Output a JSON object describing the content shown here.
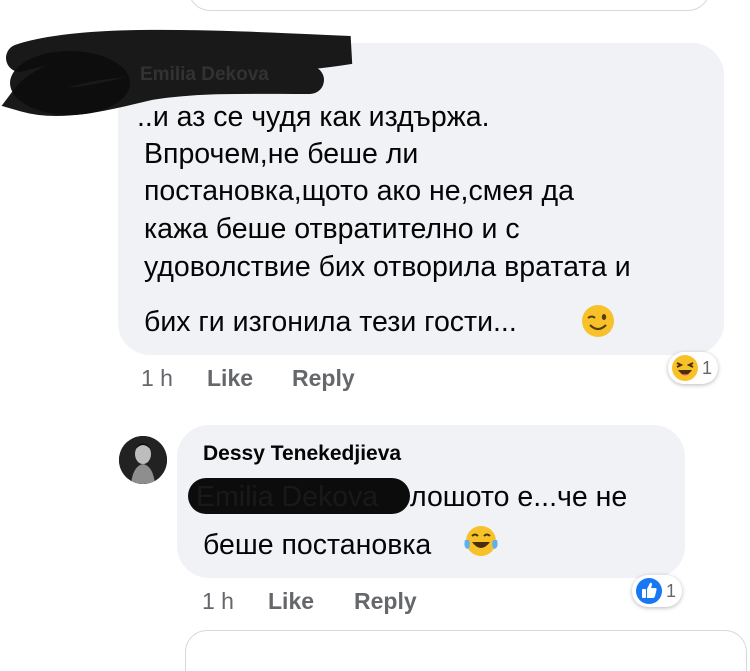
{
  "comment_1": {
    "author": "Emilia Dekova",
    "lines": [
      "..и аз се чудя как издържа.",
      "Впрочем,не беше ли",
      "постановка,щото ако не,смея да",
      "кажа беше отвратително и с",
      "удоволствие бих отворила вратата и",
      "бих ги изгонила тези гости..."
    ],
    "emoji": "wink-emoji",
    "timestamp": "1 h",
    "like_label": "Like",
    "reply_label": "Reply",
    "reaction": {
      "icon": "haha-laugh-emoji",
      "count": "1"
    }
  },
  "comment_2": {
    "author": "Dessy Tenekedjieva",
    "mention": "Emilia Dekova",
    "line_1_rest": " лошото е...че не",
    "line_2": "беше постановка",
    "emoji": "tears-of-joy-emoji",
    "timestamp": "1 h",
    "like_label": "Like",
    "reply_label": "Reply",
    "reaction": {
      "icon": "like-thumbs-up-icon",
      "count": "1"
    }
  },
  "colors": {
    "bubble_bg": "#f0f2f5",
    "meta_text": "#65676b",
    "like_blue": "#1877f2",
    "emoji_yellow": "#f7c12a"
  }
}
